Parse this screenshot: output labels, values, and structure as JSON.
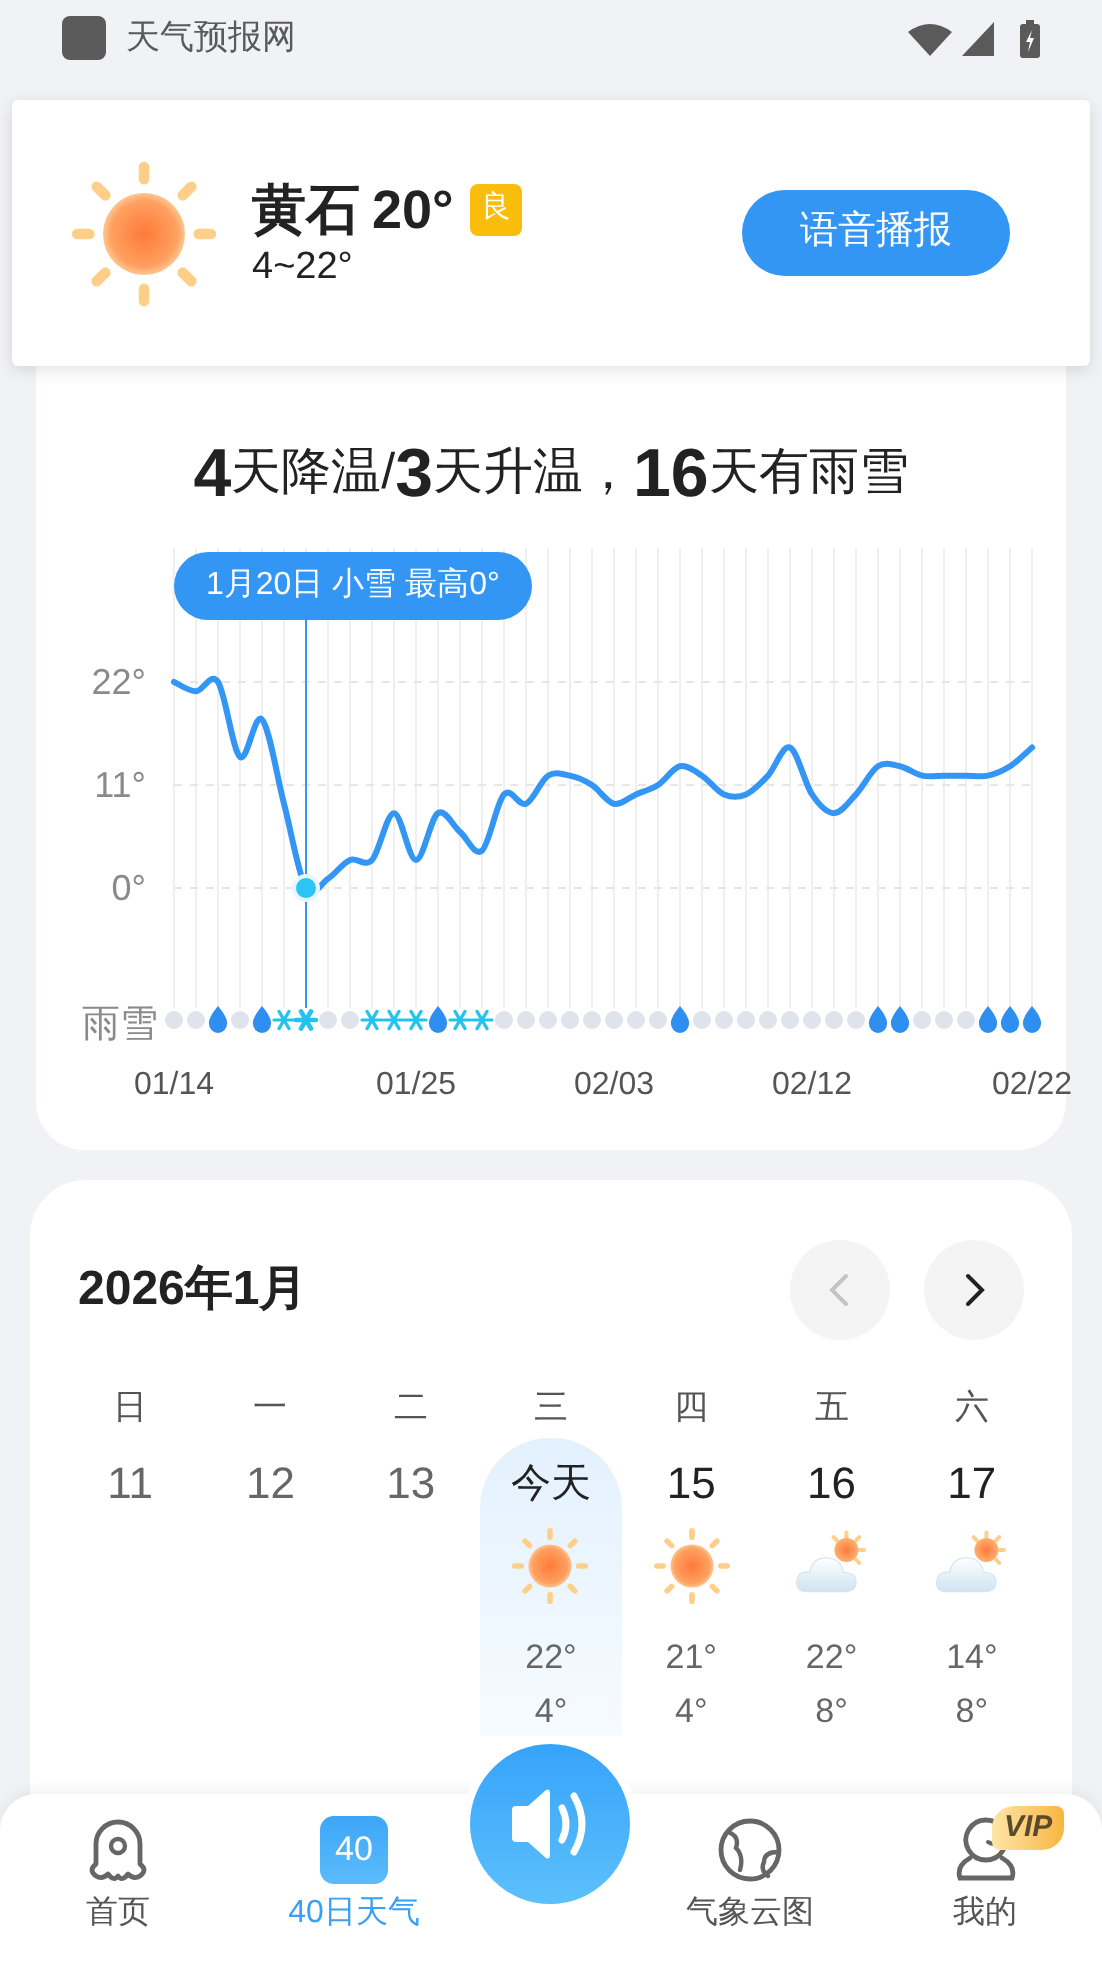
{
  "status_bar": {
    "app_name": "天气预报网"
  },
  "current": {
    "city": "黄石",
    "temp": "20°",
    "aqi": "良",
    "range": "4~22°",
    "voice_button": "语音播报"
  },
  "trend": {
    "headline": "**4**天降温/**3**天升温，**16**天有雨雪",
    "chart_data": {
      "type": "line",
      "categories": [
        "01/14",
        null,
        null,
        null,
        null,
        null,
        null,
        null,
        null,
        null,
        null,
        "01/25",
        null,
        null,
        null,
        null,
        null,
        null,
        null,
        null,
        "02/03",
        null,
        null,
        null,
        null,
        null,
        null,
        null,
        null,
        "02/12",
        null,
        null,
        null,
        null,
        null,
        null,
        null,
        null,
        null,
        "02/22"
      ],
      "series": [
        {
          "color": "#3396f5",
          "values": [
            22,
            21,
            22,
            14,
            18,
            9,
            0,
            1,
            3,
            3,
            8,
            3,
            8,
            6,
            4,
            10,
            9,
            12,
            12,
            11,
            9,
            10,
            11,
            13,
            12,
            10,
            10,
            12,
            15,
            10,
            8,
            10,
            13,
            13,
            12,
            12,
            12,
            12,
            13,
            15
          ]
        }
      ],
      "ylim": [
        -12.8,
        36.3
      ],
      "grid": true,
      "yticks": [
        {
          "value": 0,
          "label": "0°"
        },
        {
          "value": 11,
          "label": "11°"
        },
        {
          "value": 22,
          "label": "22°"
        }
      ],
      "annotations": [
        "1月20日 小雪 最高0°"
      ]
    },
    "precip": {
      "label": "雨雪",
      "days": [
        {
          "kind": "none",
          "selected": false
        },
        {
          "kind": "none",
          "selected": false
        },
        {
          "kind": "rain",
          "selected": false
        },
        {
          "kind": "none",
          "selected": false
        },
        {
          "kind": "rain",
          "selected": false
        },
        {
          "kind": "snow",
          "selected": false
        },
        {
          "kind": "snow",
          "selected": true
        },
        {
          "kind": "none",
          "selected": false
        },
        {
          "kind": "none",
          "selected": false
        },
        {
          "kind": "snow",
          "selected": false
        },
        {
          "kind": "snow",
          "selected": false
        },
        {
          "kind": "snow",
          "selected": false
        },
        {
          "kind": "rain",
          "selected": false
        },
        {
          "kind": "snow",
          "selected": false
        },
        {
          "kind": "snow",
          "selected": false
        },
        {
          "kind": "none",
          "selected": false
        },
        {
          "kind": "none",
          "selected": false
        },
        {
          "kind": "none",
          "selected": false
        },
        {
          "kind": "none",
          "selected": false
        },
        {
          "kind": "none",
          "selected": false
        },
        {
          "kind": "none",
          "selected": false
        },
        {
          "kind": "none",
          "selected": false
        },
        {
          "kind": "none",
          "selected": false
        },
        {
          "kind": "rain",
          "selected": false
        },
        {
          "kind": "none",
          "selected": false
        },
        {
          "kind": "none",
          "selected": false
        },
        {
          "kind": "none",
          "selected": false
        },
        {
          "kind": "none",
          "selected": false
        },
        {
          "kind": "none",
          "selected": false
        },
        {
          "kind": "none",
          "selected": false
        },
        {
          "kind": "none",
          "selected": false
        },
        {
          "kind": "none",
          "selected": false
        },
        {
          "kind": "rain",
          "selected": false
        },
        {
          "kind": "rain",
          "selected": false
        },
        {
          "kind": "none",
          "selected": false
        },
        {
          "kind": "none",
          "selected": false
        },
        {
          "kind": "none",
          "selected": false
        },
        {
          "kind": "rain",
          "selected": false
        },
        {
          "kind": "rain",
          "selected": false
        },
        {
          "kind": "rain",
          "selected": false
        }
      ]
    }
  },
  "calendar": {
    "title": "2026年1月",
    "prev": {
      "disabled": true
    },
    "next": {
      "disabled": false
    },
    "weekdays": [
      "日",
      "一",
      "二",
      "三",
      "四",
      "五",
      "六"
    ],
    "days": [
      {
        "kind": "past",
        "label": "11",
        "selected": false
      },
      {
        "kind": "past",
        "label": "12",
        "selected": false
      },
      {
        "kind": "past",
        "label": "13",
        "selected": false
      },
      {
        "kind": "sunny",
        "label": "今天",
        "selected": true,
        "high": "22°",
        "low": "4°"
      },
      {
        "kind": "sunny",
        "label": "15",
        "selected": false,
        "high": "21°",
        "low": "4°"
      },
      {
        "kind": "partly_cloudy",
        "label": "16",
        "selected": false,
        "high": "22°",
        "low": "8°"
      },
      {
        "kind": "partly_cloudy",
        "label": "17",
        "selected": false,
        "high": "14°",
        "low": "8°"
      }
    ]
  },
  "nav": {
    "items": [
      {
        "kind": "home",
        "label": "首页",
        "selected": false
      },
      {
        "kind": "calendar",
        "label": "40日天气",
        "icon_text": "40",
        "selected": true
      },
      {
        "kind": "globe",
        "label": "气象云图",
        "selected": false
      },
      {
        "kind": "profile",
        "label": "我的",
        "selected": false,
        "badge": "VIP"
      }
    ]
  }
}
